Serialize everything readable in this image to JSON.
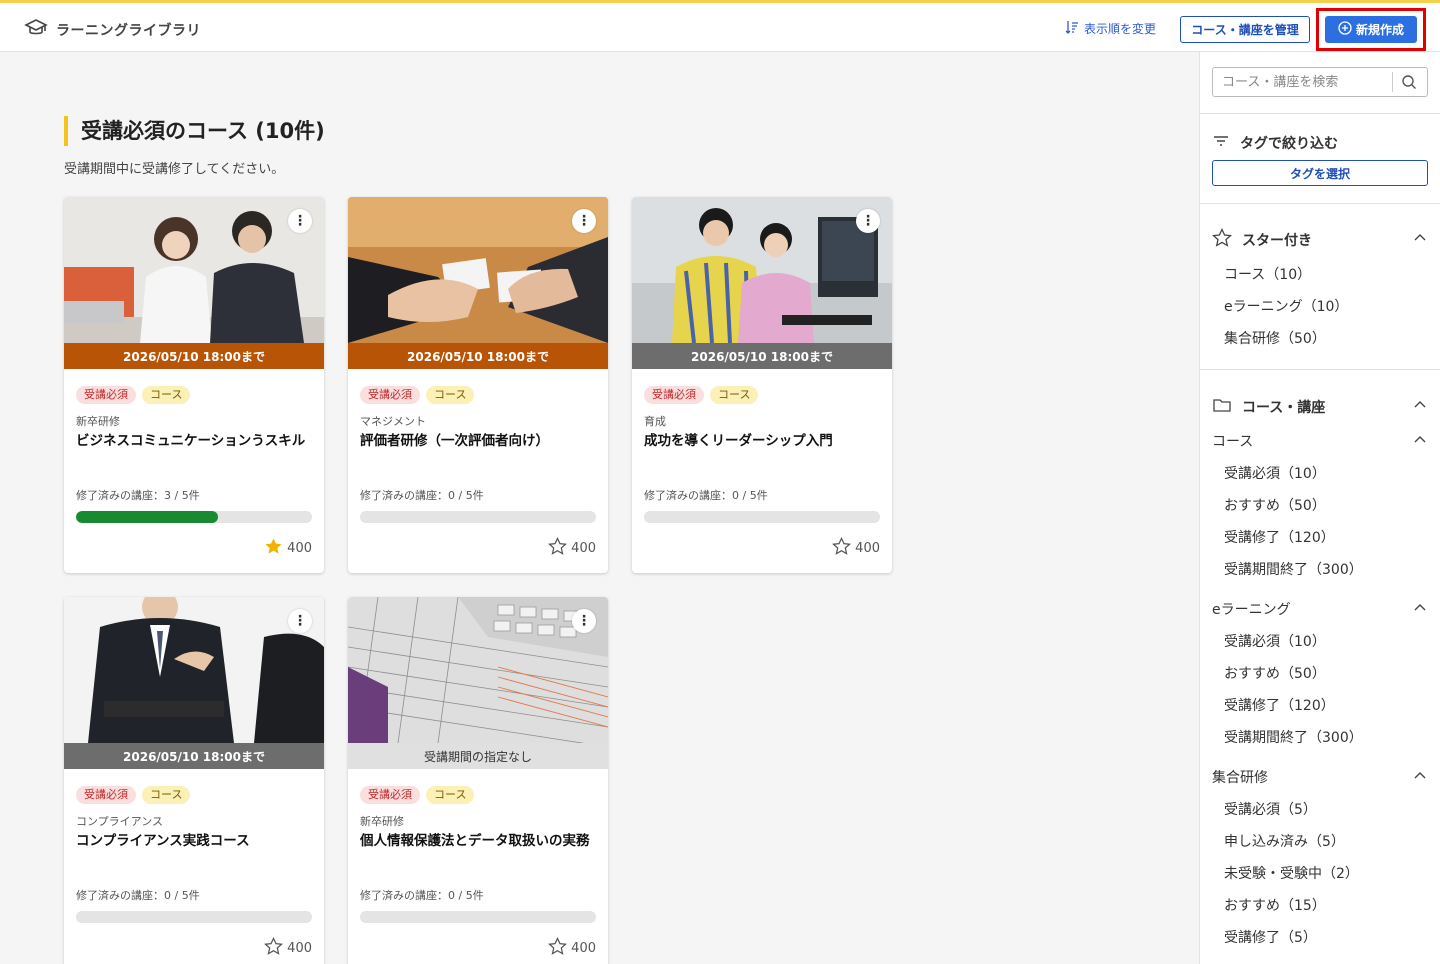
{
  "header": {
    "app_title": "ラーニングライブラリ",
    "sort_label": "表示順を変更",
    "manage_label": "コース・講座を管理",
    "new_label": "新規作成"
  },
  "section": {
    "heading": "受講必須のコース (10件)",
    "subtitle": "受講期間中に受講修了してください。"
  },
  "cards": [
    {
      "deadline": "2026/05/10 18:00まで",
      "deadline_style": "orange",
      "tag_required": "受講必須",
      "tag_type": "コース",
      "category": "新卒研修",
      "title": "ビジネスコミュニケーションうスキル",
      "progress_label": "修了済みの講座：3 / 5件",
      "progress": 0.6,
      "stars": "400",
      "starred": true
    },
    {
      "deadline": "2026/05/10 18:00まで",
      "deadline_style": "orange",
      "tag_required": "受講必須",
      "tag_type": "コース",
      "category": "マネジメント",
      "title": "評価者研修（一次評価者向け）",
      "progress_label": "修了済みの講座：0 / 5件",
      "progress": 0,
      "stars": "400",
      "starred": false
    },
    {
      "deadline": "2026/05/10 18:00まで",
      "deadline_style": "gray",
      "tag_required": "受講必須",
      "tag_type": "コース",
      "category": "育成",
      "title": "成功を導くリーダーシップ入門",
      "progress_label": "修了済みの講座：0 / 5件",
      "progress": 0,
      "stars": "400",
      "starred": false
    },
    {
      "deadline": "2026/05/10 18:00まで",
      "deadline_style": "gray",
      "tag_required": "受講必須",
      "tag_type": "コース",
      "category": "コンプライアンス",
      "title": "コンプライアンス実践コース",
      "progress_label": "修了済みの講座：0 / 5件",
      "progress": 0,
      "stars": "400",
      "starred": false
    },
    {
      "deadline": "受講期間の指定なし",
      "deadline_style": "light",
      "tag_required": "受講必須",
      "tag_type": "コース",
      "category": "新卒研修",
      "title": "個人情報保護法とデータ取扱いの実務",
      "progress_label": "修了済みの講座：0 / 5件",
      "progress": 0,
      "stars": "400",
      "starred": false
    }
  ],
  "sidebar": {
    "search_placeholder": "コース・講座を検索",
    "filter_label": "タグで絞り込む",
    "tag_button": "タグを選択",
    "starred": {
      "label": "スター付き",
      "items": [
        "コース（10）",
        "eラーニング（10）",
        "集合研修（50）"
      ]
    },
    "courses": {
      "label": "コース・講座",
      "course_label": "コース",
      "course_items": [
        "受講必須（10）",
        "おすすめ（50）",
        "受講修了（120）",
        "受講期間終了（300）"
      ],
      "elearning_label": "eラーニング",
      "elearning_items": [
        "受講必須（10）",
        "おすすめ（50）",
        "受講修了（120）",
        "受講期間終了（300）"
      ],
      "group_label": "集合研修",
      "group_items": [
        "受講必須（5）",
        "申し込み済み（5）",
        "未受験・受験中（2）",
        "おすすめ（15）",
        "受講修了（5）"
      ]
    }
  },
  "colors": {
    "accent_yellow": "#f3c51c",
    "primary_blue": "#2c6fe0",
    "deadline_orange": "#b85406",
    "progress_green": "#198a2f",
    "highlight_red": "#e00000"
  }
}
